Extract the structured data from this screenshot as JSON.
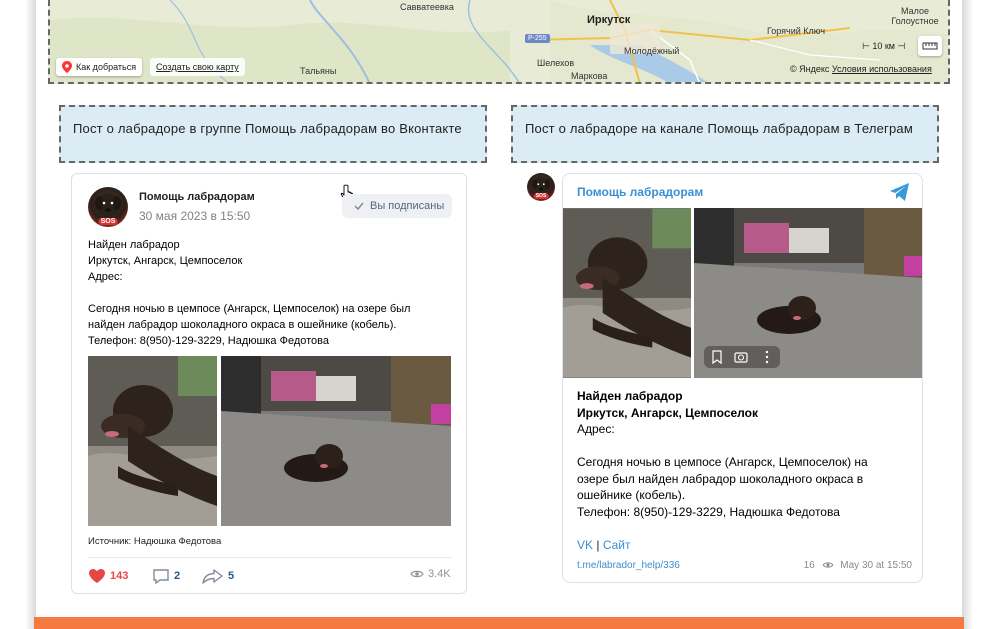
{
  "map": {
    "places": {
      "savvateevka": "Савватеевка",
      "irkutsk": "Иркутск",
      "molodezhny": "Молодёжный",
      "shelekhov": "Шелехов",
      "markova": "Маркова",
      "talyany": "Тальяны",
      "goryachiy_klyuch": "Горячий Ключ",
      "maloe_golustnoe": "Малое Голоустное",
      "road": "Р-255"
    },
    "route_button": "Как добраться",
    "create_map": "Создать свою карту",
    "scale": "10 км",
    "copyright_prefix": "© Яндекс",
    "terms": "Условия использования"
  },
  "headers": {
    "vk": "Пост о лабрадоре в группе Помощь лабрадорам во Вконтакте",
    "tg": "Пост о лабрадоре на канале Помощь лабрадорам в Телеграм"
  },
  "vk_post": {
    "group_name": "Помощь лабрадорам",
    "date": "30 мая 2023 в 15:50",
    "subscribed_label": "Вы подписаны",
    "avatar_badge": "SOS",
    "lines": [
      "Найден лабрадор",
      "Иркутск, Ангарск, Цемпоселок",
      "Адрес:",
      "",
      "Сегодня ночью в цемпосе (Ангарск, Цемпоселок) на озере был",
      "найден лабрадор шоколадного окраса в ошейнике (кобель).",
      "Телефон: 8(950)-129-3229, Надюшка Федотова"
    ],
    "source": "Источник: Надюшка Федотова",
    "likes": "143",
    "comments": "2",
    "shares": "5",
    "views": "3.4K"
  },
  "tg_post": {
    "channel_name": "Помощь лабрадорам",
    "avatar_badge": "SOS",
    "bold_lines": [
      "Найден лабрадор",
      "Иркутск, Ангарск, Цемпоселок"
    ],
    "lines": [
      "Адрес:",
      "",
      "Сегодня ночью в цемпосе (Ангарск, Цемпоселок) на",
      "озере был найден лабрадор шоколадного окраса в",
      "ошейнике (кобель).",
      "Телефон: 8(950)-129-3229, Надюшка Федотова"
    ],
    "link_vk": "VK",
    "link_sep": " | ",
    "link_site": "Сайт",
    "url": "t.me/labrador_help/336",
    "views": "16",
    "date": "May 30 at 15:50"
  },
  "colors": {
    "accent_orange": "#f47a42",
    "header_box": "#dcecf5",
    "vk_like": "#e64646",
    "tg_blue": "#3a8fd4"
  }
}
